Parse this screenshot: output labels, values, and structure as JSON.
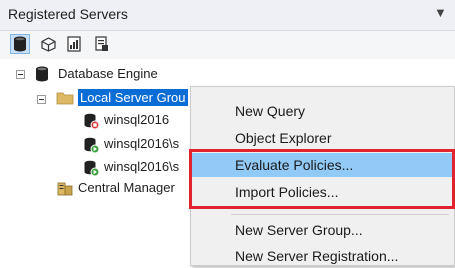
{
  "window": {
    "title": "Registered Servers"
  },
  "toolbar": {
    "buttons": [
      {
        "icon": "database-engine-icon",
        "active": true
      },
      {
        "icon": "analysis-services-cube-icon",
        "active": false
      },
      {
        "icon": "reporting-services-icon",
        "active": false
      },
      {
        "icon": "integration-services-icon",
        "active": false
      }
    ]
  },
  "tree": {
    "root": "Database Engine",
    "group": "Local Server Grou",
    "servers": [
      {
        "name": "winsql2016",
        "status": "stopped"
      },
      {
        "name": "winsql2016\\s",
        "status": "running"
      },
      {
        "name": "winsql2016\\s",
        "status": "running"
      }
    ],
    "central": "Central Manager"
  },
  "context_menu": {
    "items": [
      "New Query",
      "Object Explorer",
      "Evaluate Policies...",
      "Import Policies...",
      "New Server Group...",
      "New Server Registration..."
    ],
    "hovered_item": "Evaluate Policies..."
  },
  "colors": {
    "selection": "#0a6dd6",
    "menu_hover": "#91c9f7",
    "callout_border": "#e0242f",
    "status_stopped": "#d83b3b",
    "status_running": "#3ca03c"
  }
}
